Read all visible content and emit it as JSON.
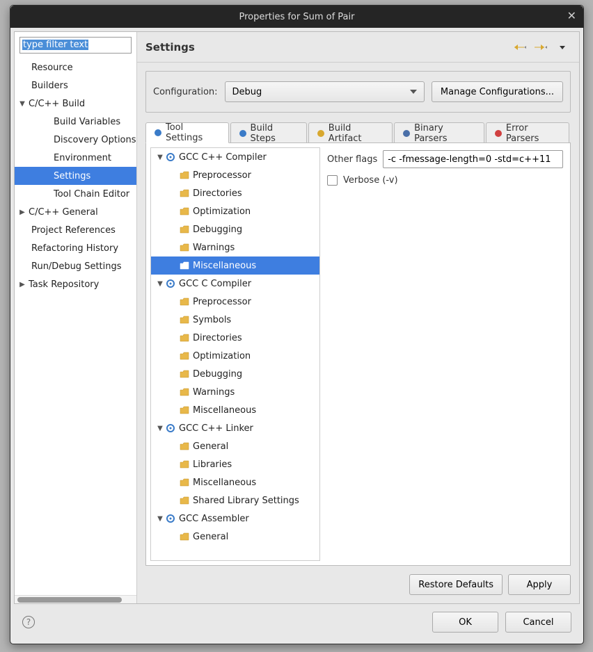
{
  "window": {
    "title": "Properties for Sum of Pair"
  },
  "sidebar": {
    "filter_placeholder": "type filter text",
    "items": [
      {
        "label": "Resource",
        "depth": 0,
        "twisty": ""
      },
      {
        "label": "Builders",
        "depth": 0,
        "twisty": ""
      },
      {
        "label": "C/C++ Build",
        "depth": 0,
        "twisty": "down"
      },
      {
        "label": "Build Variables",
        "depth": 1,
        "twisty": ""
      },
      {
        "label": "Discovery Options",
        "depth": 1,
        "twisty": ""
      },
      {
        "label": "Environment",
        "depth": 1,
        "twisty": ""
      },
      {
        "label": "Settings",
        "depth": 1,
        "twisty": "",
        "selected": true
      },
      {
        "label": "Tool Chain Editor",
        "depth": 1,
        "twisty": ""
      },
      {
        "label": "C/C++ General",
        "depth": 0,
        "twisty": "right"
      },
      {
        "label": "Project References",
        "depth": 0,
        "twisty": ""
      },
      {
        "label": "Refactoring History",
        "depth": 0,
        "twisty": ""
      },
      {
        "label": "Run/Debug Settings",
        "depth": 0,
        "twisty": ""
      },
      {
        "label": "Task Repository",
        "depth": 0,
        "twisty": "right"
      }
    ]
  },
  "header": {
    "title": "Settings"
  },
  "config": {
    "label": "Configuration:",
    "value": "Debug",
    "manage_btn": "Manage Configurations..."
  },
  "tabs": [
    {
      "label": "Tool Settings",
      "icon": "tool-settings-icon",
      "active": true,
      "color": "#3a7bc8"
    },
    {
      "label": "Build Steps",
      "icon": "build-steps-icon",
      "color": "#3a7bc8"
    },
    {
      "label": "Build Artifact",
      "icon": "build-artifact-icon",
      "color": "#d8a82f"
    },
    {
      "label": "Binary Parsers",
      "icon": "binary-parsers-icon",
      "color": "#4a6fa8"
    },
    {
      "label": "Error Parsers",
      "icon": "error-parsers-icon",
      "color": "#d04040"
    }
  ],
  "tool_tree": [
    {
      "label": "GCC C++ Compiler",
      "icon": "gear",
      "tw": "down",
      "d": 0
    },
    {
      "label": "Preprocessor",
      "icon": "folder",
      "d": 1
    },
    {
      "label": "Directories",
      "icon": "folder",
      "d": 1
    },
    {
      "label": "Optimization",
      "icon": "folder",
      "d": 1
    },
    {
      "label": "Debugging",
      "icon": "folder",
      "d": 1
    },
    {
      "label": "Warnings",
      "icon": "folder",
      "d": 1
    },
    {
      "label": "Miscellaneous",
      "icon": "folder",
      "d": 1,
      "selected": true
    },
    {
      "label": "GCC C Compiler",
      "icon": "gear",
      "tw": "down",
      "d": 0
    },
    {
      "label": "Preprocessor",
      "icon": "folder",
      "d": 1
    },
    {
      "label": "Symbols",
      "icon": "folder",
      "d": 1
    },
    {
      "label": "Directories",
      "icon": "folder",
      "d": 1
    },
    {
      "label": "Optimization",
      "icon": "folder",
      "d": 1
    },
    {
      "label": "Debugging",
      "icon": "folder",
      "d": 1
    },
    {
      "label": "Warnings",
      "icon": "folder",
      "d": 1
    },
    {
      "label": "Miscellaneous",
      "icon": "folder",
      "d": 1
    },
    {
      "label": "GCC C++ Linker",
      "icon": "gear",
      "tw": "down",
      "d": 0
    },
    {
      "label": "General",
      "icon": "folder",
      "d": 1
    },
    {
      "label": "Libraries",
      "icon": "folder",
      "d": 1
    },
    {
      "label": "Miscellaneous",
      "icon": "folder",
      "d": 1
    },
    {
      "label": "Shared Library Settings",
      "icon": "folder",
      "d": 1
    },
    {
      "label": "GCC Assembler",
      "icon": "gear",
      "tw": "down",
      "d": 0
    },
    {
      "label": "General",
      "icon": "folder",
      "d": 1
    }
  ],
  "form": {
    "other_flags_label": "Other flags",
    "other_flags_value": "-c -fmessage-length=0 -std=c++11",
    "verbose_label": "Verbose (-v)"
  },
  "actions": {
    "restore": "Restore Defaults",
    "apply": "Apply"
  },
  "footer": {
    "ok": "OK",
    "cancel": "Cancel"
  }
}
